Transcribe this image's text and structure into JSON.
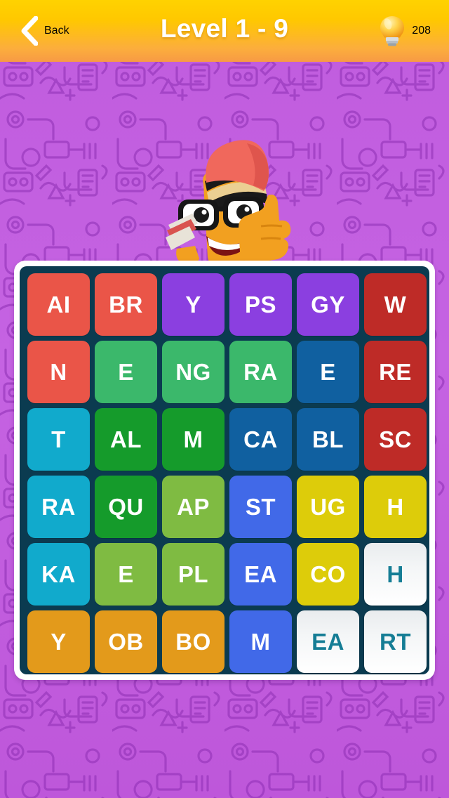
{
  "header": {
    "back_label": "Back",
    "back_icon": "chevron-left-icon",
    "title": "Level 1 - 9",
    "hint_icon": "lightbulb-icon",
    "hint_count": "208",
    "gradient_top": "#FFD200",
    "gradient_bottom": "#F79A45",
    "text_color": "#FFFFFF"
  },
  "background": {
    "color": "#C45FE0",
    "pattern": "doodle-line-art",
    "pattern_color": "#9B3FBE"
  },
  "mascot": {
    "name": "pencil-character",
    "description": "orange pencil character with black glasses, red cap and thumbs up",
    "cap_color": "#F0685C",
    "body_color": "#F2A020"
  },
  "board": {
    "frame_color": "#FFFFFF",
    "inner_color": "#0B3B50",
    "rows": 6,
    "columns": 6,
    "selected_text_color": "#157D95",
    "tiles": [
      {
        "text": "AI",
        "color": "#EA5548",
        "selected": false
      },
      {
        "text": "BR",
        "color": "#EA5548",
        "selected": false
      },
      {
        "text": "Y",
        "color": "#8B3FE0",
        "selected": false
      },
      {
        "text": "PS",
        "color": "#8B3FE0",
        "selected": false
      },
      {
        "text": "GY",
        "color": "#8B3FE0",
        "selected": false
      },
      {
        "text": "W",
        "color": "#BE2B27",
        "selected": false
      },
      {
        "text": "N",
        "color": "#EA5548",
        "selected": false
      },
      {
        "text": "E",
        "color": "#3BB86B",
        "selected": false
      },
      {
        "text": "NG",
        "color": "#3BB86B",
        "selected": false
      },
      {
        "text": "RA",
        "color": "#3BB86B",
        "selected": false
      },
      {
        "text": "E",
        "color": "#1060A0",
        "selected": false
      },
      {
        "text": "RE",
        "color": "#BE2B27",
        "selected": false
      },
      {
        "text": "T",
        "color": "#11AACC",
        "selected": false
      },
      {
        "text": "AL",
        "color": "#159B2B",
        "selected": false
      },
      {
        "text": "M",
        "color": "#159B2B",
        "selected": false
      },
      {
        "text": "CA",
        "color": "#1060A0",
        "selected": false
      },
      {
        "text": "BL",
        "color": "#1060A0",
        "selected": false
      },
      {
        "text": "SC",
        "color": "#BE2B27",
        "selected": false
      },
      {
        "text": "RA",
        "color": "#11AACC",
        "selected": false
      },
      {
        "text": "QU",
        "color": "#159B2B",
        "selected": false
      },
      {
        "text": "AP",
        "color": "#7FBB42",
        "selected": false
      },
      {
        "text": "ST",
        "color": "#4169E8",
        "selected": false
      },
      {
        "text": "UG",
        "color": "#DDCC0A",
        "selected": false
      },
      {
        "text": "H",
        "color": "#DDCC0A",
        "selected": false
      },
      {
        "text": "KA",
        "color": "#11AACC",
        "selected": false
      },
      {
        "text": "E",
        "color": "#7FBB42",
        "selected": false
      },
      {
        "text": "PL",
        "color": "#7FBB42",
        "selected": false
      },
      {
        "text": "EA",
        "color": "#4169E8",
        "selected": false
      },
      {
        "text": "CO",
        "color": "#DDCC0A",
        "selected": false
      },
      {
        "text": "H",
        "color": "#FFFFFF",
        "selected": true
      },
      {
        "text": "Y",
        "color": "#E39A1B",
        "selected": false
      },
      {
        "text": "OB",
        "color": "#E39A1B",
        "selected": false
      },
      {
        "text": "BO",
        "color": "#E39A1B",
        "selected": false
      },
      {
        "text": "M",
        "color": "#4169E8",
        "selected": false
      },
      {
        "text": "EA",
        "color": "#FFFFFF",
        "selected": true
      },
      {
        "text": "RT",
        "color": "#FFFFFF",
        "selected": true
      }
    ]
  }
}
